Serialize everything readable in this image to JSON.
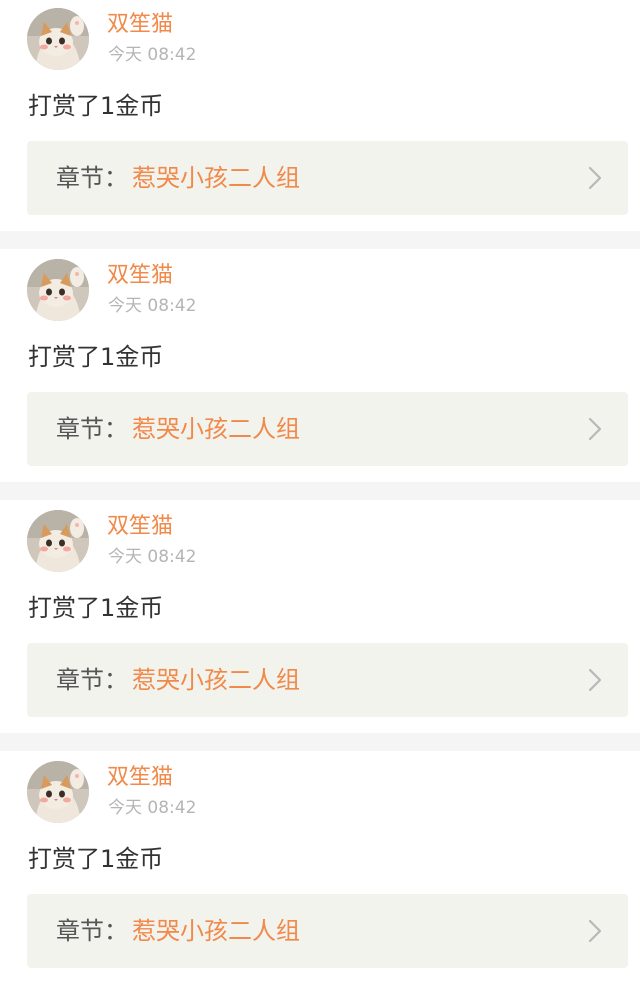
{
  "feed": {
    "items": [
      {
        "user": "双笙猫",
        "time": "今天 08:42",
        "message": "打赏了1金币",
        "chapter_label": "章节：",
        "chapter_title": "惹哭小孩二人组"
      },
      {
        "user": "双笙猫",
        "time": "今天 08:42",
        "message": "打赏了1金币",
        "chapter_label": "章节：",
        "chapter_title": "惹哭小孩二人组"
      },
      {
        "user": "双笙猫",
        "time": "今天 08:42",
        "message": "打赏了1金币",
        "chapter_label": "章节：",
        "chapter_title": "惹哭小孩二人组"
      },
      {
        "user": "双笙猫",
        "time": "今天 08:42",
        "message": "打赏了1金币",
        "chapter_label": "章节：",
        "chapter_title": "惹哭小孩二人组"
      }
    ]
  },
  "colors": {
    "accent": "#f0894a",
    "page_bg": "#f5f5f5",
    "card_bg": "#ffffff",
    "chapter_bg": "#f3f3ee",
    "text": "#333333",
    "muted": "#b5b5b5"
  },
  "icons": {
    "avatar": "cat-photo",
    "chapter_arrow": "chevron-right-icon"
  }
}
